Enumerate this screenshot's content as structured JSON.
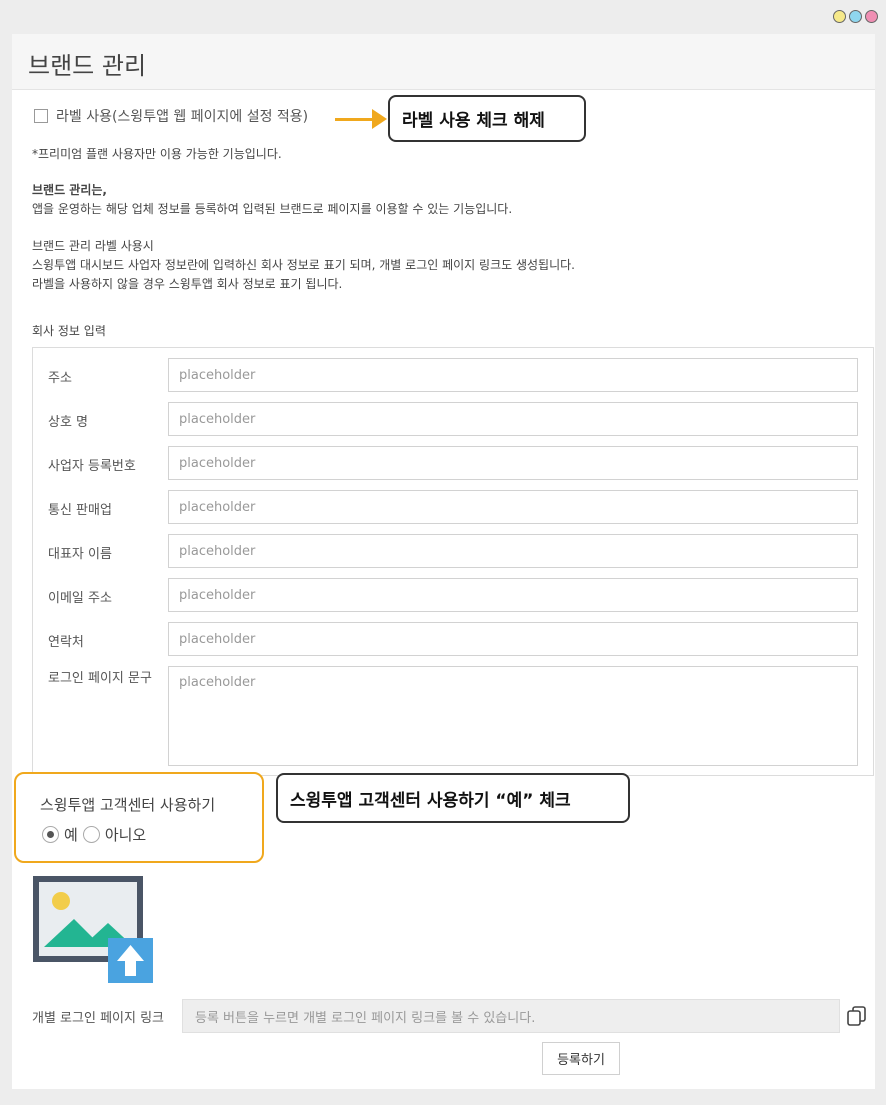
{
  "window": {
    "dot_colors": [
      "#f6e98a",
      "#8fd6ee",
      "#ef8fb3"
    ]
  },
  "header": {
    "title": "브랜드 관리"
  },
  "label_checkbox": {
    "label": "라벨 사용(스윙투앱 웹 페이지에 설정 적용)",
    "checked": false
  },
  "callouts": {
    "label_uncheck": "라벨 사용 체크 해제",
    "customer_center": "스윙투앱 고객센터 사용하기 “예” 체크"
  },
  "notes": {
    "premium": "*프리미엄 플랜 사용자만 이용 가능한 기능입니다.",
    "brand_heading": "브랜드 관리는,",
    "brand_desc": "앱을 운영하는 해당 업체 정보를 등록하여 입력된 브랜드로 페이지를 이용할 수 있는 기능입니다.",
    "label_heading": "브랜드 관리 라벨 사용시",
    "label_line1": "스윙투앱 대시보드 사업자 정보란에 입력하신 회사 정보로 표기 되며, 개별 로그인 페이지 링크도 생성됩니다.",
    "label_line2": "라벨을 사용하지 않을 경우 스윙투앱 회사 정보로 표기 됩니다."
  },
  "company_form": {
    "section_title": "회사 정보 입력",
    "fields": [
      {
        "label": "주소",
        "placeholder": "placeholder"
      },
      {
        "label": "상호 명",
        "placeholder": "placeholder"
      },
      {
        "label": "사업자 등록번호",
        "placeholder": "placeholder"
      },
      {
        "label": "통신 판매업",
        "placeholder": "placeholder"
      },
      {
        "label": "대표자 이름",
        "placeholder": "placeholder"
      },
      {
        "label": "이메일 주소",
        "placeholder": "placeholder"
      },
      {
        "label": "연락처",
        "placeholder": "placeholder"
      },
      {
        "label": "로그인 페이지 문구",
        "placeholder": "placeholder"
      }
    ]
  },
  "customer_center": {
    "title": "스윙투앱 고객센터 사용하기",
    "options": [
      "예",
      "아니오"
    ],
    "selected": "예"
  },
  "image_upload": {
    "icon": "image-upload-icon"
  },
  "login_link": {
    "label": "개별 로그인 페이지 링크",
    "value": "등록 버튼을 누르면 개별 로그인 페이지 링크를 볼 수 있습니다.",
    "copy_icon": "copy-icon"
  },
  "submit": {
    "label": "등록하기"
  },
  "colors": {
    "accent": "#f0a81d",
    "upload_blue": "#4aa3e0",
    "image_frame": "#4a5566",
    "mountain_green": "#23b592",
    "sun_yellow": "#f2cd4a"
  }
}
